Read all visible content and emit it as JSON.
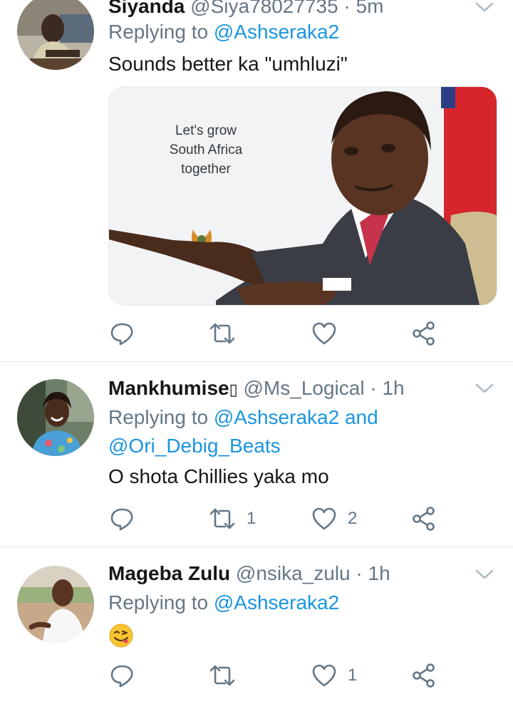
{
  "tweets": [
    {
      "name": "Siyanda",
      "handle": "@Siya78027735",
      "separator": "·",
      "time": "5m",
      "replying_prefix": "Replying to",
      "mention": "@Ashseraka2",
      "text": "Sounds better ka \"umhluzi\"",
      "media": {
        "poster_lines": [
          "Let's grow",
          "South Africa",
          "together"
        ]
      },
      "reply_count": "",
      "retweet_count": "",
      "like_count": ""
    },
    {
      "name": "Mankhumise",
      "name_glyph": "▯",
      "handle": "@Ms_Logical",
      "separator": "·",
      "time": "1h",
      "replying_prefix": "Replying to",
      "mention": "@Ashseraka2",
      "conjunction": "and",
      "mention2": "@Ori_Debig_Beats",
      "text": "O shota Chillies yaka mo",
      "reply_count": "",
      "retweet_count": "1",
      "like_count": "2"
    },
    {
      "name": "Mageba Zulu",
      "handle": "@nsika_zulu",
      "separator": "·",
      "time": "1h",
      "replying_prefix": "Replying to",
      "mention": "@Ashseraka2",
      "text_emoji": "face-savoring-food-emoji",
      "reply_count": "",
      "retweet_count": "",
      "like_count": "1"
    }
  ],
  "icons": {
    "reply": "reply-icon",
    "retweet": "retweet-icon",
    "like": "like-icon",
    "share": "share-icon",
    "menu": "chevron-down-icon"
  },
  "colors": {
    "link": "#1b95e0",
    "secondary_text": "#657786",
    "primary_text": "#14171a",
    "divider": "#e6ecf0"
  }
}
